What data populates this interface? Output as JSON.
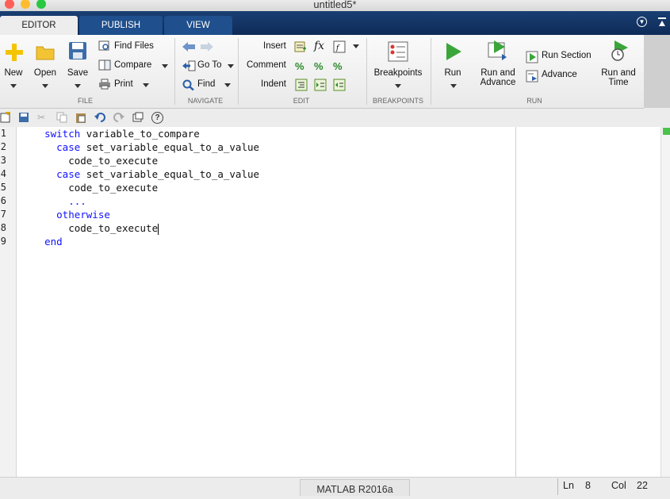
{
  "window": {
    "title": "untitled5*"
  },
  "tabs": [
    {
      "label": "EDITOR",
      "active": true
    },
    {
      "label": "PUBLISH",
      "active": false
    },
    {
      "label": "VIEW",
      "active": false
    }
  ],
  "ribbon": {
    "file": {
      "group_label": "FILE",
      "new_label": "New",
      "open_label": "Open",
      "save_label": "Save",
      "find_files_label": "Find Files",
      "compare_label": "Compare",
      "print_label": "Print"
    },
    "navigate": {
      "group_label": "NAVIGATE",
      "goto_label": "Go To",
      "find_label": "Find"
    },
    "edit": {
      "group_label": "EDIT",
      "insert_label": "Insert",
      "fx_label": "fx",
      "comment_label": "Comment",
      "indent_label": "Indent"
    },
    "breakpoints": {
      "group_label": "BREAKPOINTS",
      "breakpoints_label": "Breakpoints"
    },
    "run": {
      "group_label": "RUN",
      "run_label": "Run",
      "run_advance_line1": "Run and",
      "run_advance_line2": "Advance",
      "run_section_label": "Run Section",
      "advance_label": "Advance",
      "run_time_line1": "Run and",
      "run_time_line2": "Time"
    }
  },
  "editor": {
    "line_numbers": [
      "1",
      "2",
      "3",
      "4",
      "5",
      "6",
      "7",
      "8",
      "9"
    ],
    "lines": [
      {
        "indent": "    ",
        "keyword": "switch",
        "rest": " variable_to_compare"
      },
      {
        "indent": "      ",
        "keyword": "case",
        "rest": " set_variable_equal_to_a_value"
      },
      {
        "indent": "        ",
        "keyword": "",
        "rest": "code_to_execute"
      },
      {
        "indent": "      ",
        "keyword": "case",
        "rest": " set_variable_equal_to_a_value"
      },
      {
        "indent": "        ",
        "keyword": "",
        "rest": "code_to_execute"
      },
      {
        "indent": "        ",
        "keyword": "...",
        "rest": ""
      },
      {
        "indent": "      ",
        "keyword": "otherwise",
        "rest": ""
      },
      {
        "indent": "        ",
        "keyword": "",
        "rest": "code_to_execute"
      },
      {
        "indent": "    ",
        "keyword": "end",
        "rest": ""
      }
    ]
  },
  "statusbar": {
    "version": "MATLAB R2016a",
    "ln_label": "Ln",
    "ln_value": "8",
    "col_label": "Col",
    "col_value": "22"
  },
  "colors": {
    "keyword": "#1212ff",
    "tab_strip": "#1a3f73",
    "run_green": "#3aa63a"
  }
}
